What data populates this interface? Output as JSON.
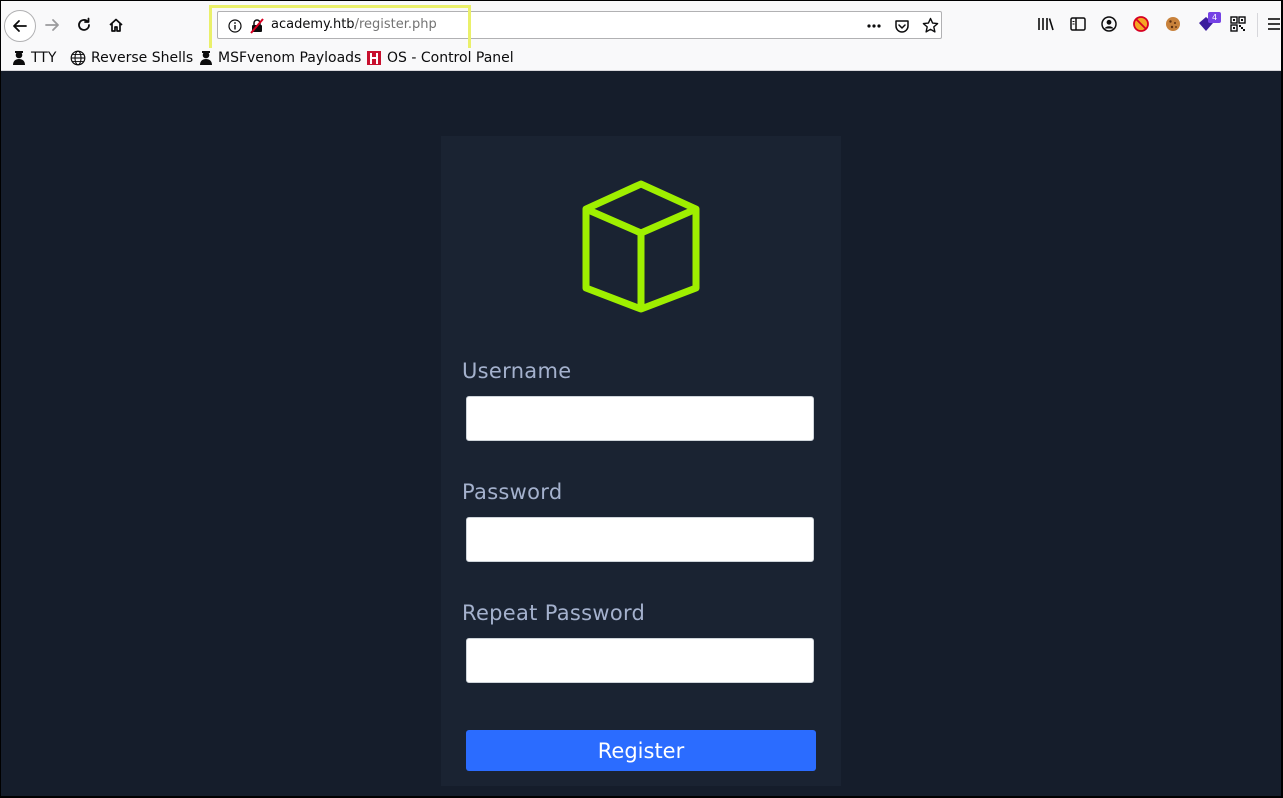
{
  "browser": {
    "url_host": "academy.htb",
    "url_path": "/register.php",
    "extension_badge": "4",
    "bookmarks": [
      {
        "label": "TTY"
      },
      {
        "label": "Reverse Shells"
      },
      {
        "label": "MSFvenom Payloads"
      },
      {
        "label": "OS - Control Panel"
      }
    ]
  },
  "form": {
    "username_label": "Username",
    "password_label": "Password",
    "repeat_password_label": "Repeat Password",
    "username_value": "",
    "password_value": "",
    "repeat_password_value": "",
    "submit_label": "Register"
  },
  "colors": {
    "page_background": "#151d2b",
    "card_background": "#1a2332",
    "logo_green": "#9fef00",
    "button_blue": "#2b6cff",
    "label_color": "#a4b1cd",
    "url_highlight": "#eaf06a"
  },
  "icons": [
    "back-arrow-icon",
    "forward-arrow-icon",
    "reload-icon",
    "home-icon",
    "info-icon",
    "insecure-lock-icon",
    "more-dots-icon",
    "pocket-icon",
    "star-icon",
    "library-icon",
    "sidebar-icon",
    "account-icon",
    "blocker-icon",
    "cookie-icon",
    "extension-icon",
    "qr-code-icon",
    "menu-icon",
    "cube-logo-icon"
  ]
}
